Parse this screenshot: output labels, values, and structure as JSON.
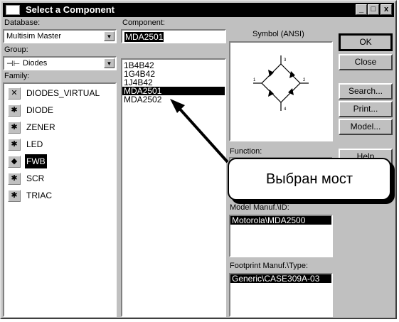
{
  "window": {
    "title": "Select a Component",
    "controls": [
      "_",
      "□",
      "x"
    ]
  },
  "database": {
    "label": "Database:",
    "value": "Multisim Master"
  },
  "group": {
    "label": "Group:",
    "value": "Diodes",
    "icon": "diode-group-icon"
  },
  "family": {
    "label": "Family:",
    "items": [
      {
        "label": "DIODES_VIRTUAL",
        "icon": "virtual-diode-icon",
        "glyph": "✕"
      },
      {
        "label": "DIODE",
        "icon": "diode-icon",
        "glyph": "✱"
      },
      {
        "label": "ZENER",
        "icon": "zener-icon",
        "glyph": "✱"
      },
      {
        "label": "LED",
        "icon": "led-icon",
        "glyph": "✱"
      },
      {
        "label": "FWB",
        "icon": "bridge-icon",
        "glyph": "◆",
        "selected": true
      },
      {
        "label": "SCR",
        "icon": "scr-icon",
        "glyph": "✱"
      },
      {
        "label": "TRIAC",
        "icon": "triac-icon",
        "glyph": "✱"
      }
    ]
  },
  "component": {
    "label": "Component:",
    "value": "MDA2501",
    "items": [
      "1B4B42",
      "1G4B42",
      "1J4B42",
      "MDA2501",
      "MDA2502"
    ],
    "selected_index": 3
  },
  "symbol": {
    "label": "Symbol (ANSI)"
  },
  "function": {
    "label": "Function:"
  },
  "model": {
    "label": "Model Manuf.\\ID:",
    "items": [
      "Motorola\\MDA2500"
    ]
  },
  "footprint": {
    "label": "Footprint Manuf.\\Type:",
    "items": [
      "Generic\\CASE309A-03"
    ]
  },
  "buttons": {
    "ok": "OK",
    "close": "Close",
    "search": "Search...",
    "print": "Print...",
    "model": "Model...",
    "help": "Help"
  },
  "callout": {
    "text": "Выбран мост"
  }
}
